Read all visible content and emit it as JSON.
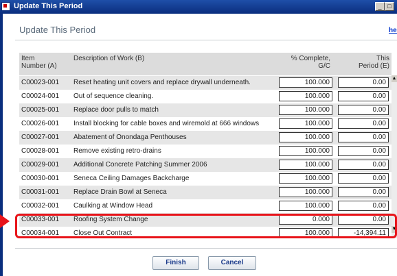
{
  "window": {
    "title": "Update This Period"
  },
  "header": {
    "title": "Update This Period",
    "help_label": "hel"
  },
  "columns": {
    "item": "Item\nNumber (A)",
    "description": "Description of Work (B)",
    "complete": "% Complete,\nG/C",
    "period": "This\nPeriod (E)"
  },
  "rows": [
    {
      "item": "C00023-001",
      "description": "Reset heating unit covers and replace drywall underneath.",
      "complete": "100.000",
      "period": "0.00"
    },
    {
      "item": "C00024-001",
      "description": "Out of sequence cleaning.",
      "complete": "100.000",
      "period": "0.00"
    },
    {
      "item": "C00025-001",
      "description": "Replace door pulls to match",
      "complete": "100.000",
      "period": "0.00"
    },
    {
      "item": "C00026-001",
      "description": "Install blocking for cable boxes and wiremold at 666 windows",
      "complete": "100.000",
      "period": "0.00"
    },
    {
      "item": "C00027-001",
      "description": "Abatement of Onondaga Penthouses",
      "complete": "100.000",
      "period": "0.00"
    },
    {
      "item": "C00028-001",
      "description": "Remove existing retro-drains",
      "complete": "100.000",
      "period": "0.00"
    },
    {
      "item": "C00029-001",
      "description": "Additional Concrete Patching Summer 2006",
      "complete": "100.000",
      "period": "0.00"
    },
    {
      "item": "C00030-001",
      "description": "Seneca Ceiling Damages Backcharge",
      "complete": "100.000",
      "period": "0.00"
    },
    {
      "item": "C00031-001",
      "description": "Replace Drain Bowl at Seneca",
      "complete": "100.000",
      "period": "0.00"
    },
    {
      "item": "C00032-001",
      "description": "Caulking at Window Head",
      "complete": "100.000",
      "period": "0.00"
    },
    {
      "item": "C00033-001",
      "description": "Roofing System Change",
      "complete": "0.000",
      "period": "0.00"
    },
    {
      "item": "C00034-001",
      "description": "Close Out Contract",
      "complete": "100.000",
      "period": "-14,394.11"
    }
  ],
  "buttons": {
    "finish": "Finish",
    "cancel": "Cancel"
  },
  "colors": {
    "highlight": "#e8141a",
    "titlebar": "#0a2e7e"
  }
}
